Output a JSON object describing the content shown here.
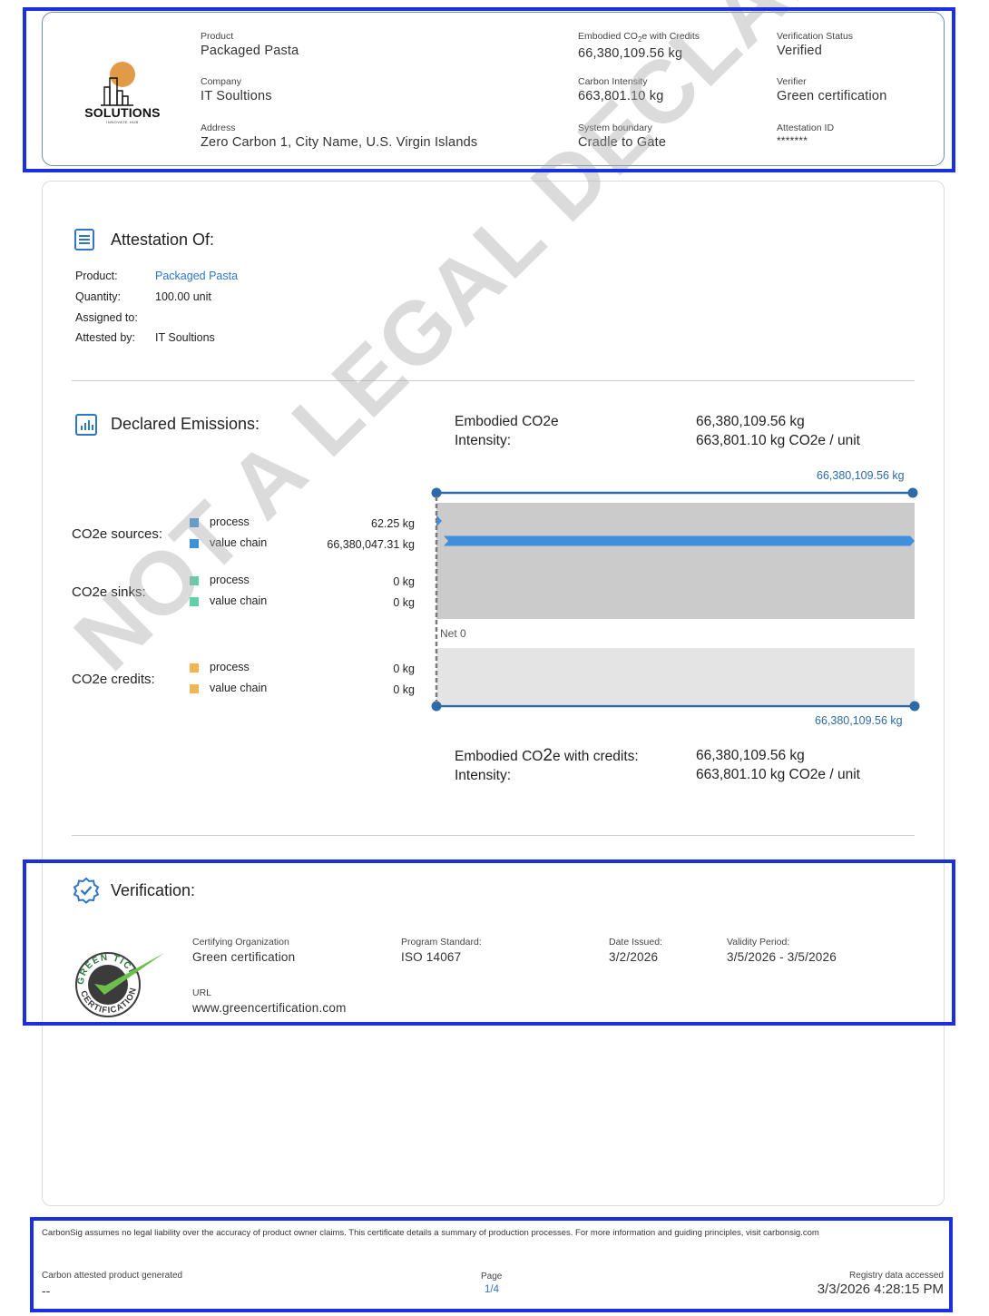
{
  "header": {
    "logo_text": "SOLUTIONS",
    "logo_subtext": "INNOVATE HUB",
    "fields": {
      "product": {
        "label": "Product",
        "value": "Packaged Pasta"
      },
      "company": {
        "label": "Company",
        "value": "IT Soultions"
      },
      "address": {
        "label": "Address",
        "value": "Zero Carbon 1, City Name, U.S. Virgin Islands"
      },
      "embodied": {
        "label_pre": "Embodied CO",
        "label_sub": "2",
        "label_post": "e with Credits",
        "value": "66,380,109.56 kg"
      },
      "intensity": {
        "label": "Carbon Intensity",
        "value": "663,801.10 kg"
      },
      "boundary": {
        "label": "System boundary",
        "value": "Cradle to Gate"
      },
      "verification_status": {
        "label": "Verification Status",
        "value": "Verified"
      },
      "verifier": {
        "label": "Verifier",
        "value": "Green certification"
      },
      "attestation_id": {
        "label": "Attestation ID",
        "value": "*******"
      }
    }
  },
  "attestation": {
    "title": "Attestation Of:",
    "rows": [
      {
        "key": "Product:",
        "value": "Packaged Pasta"
      },
      {
        "key": "Quantity:",
        "value": "100.00 unit"
      },
      {
        "key": "Assigned to:",
        "value": ""
      },
      {
        "key": "Attested by:",
        "value": "IT Soultions"
      }
    ]
  },
  "emissions": {
    "title": "Declared Emissions:",
    "embodied_label": "Embodied CO2e",
    "intensity_label": "Intensity:",
    "embodied_value": "66,380,109.56 kg",
    "intensity_value": "663,801.10 kg CO2e / unit",
    "top_total_label": "66,380,109.56 kg",
    "bottom_total_label": "66,380,109.56 kg",
    "net_label": "Net 0",
    "credits_label_pre": "Embodied CO",
    "credits_label_sub": "2",
    "credits_label_post": "e with credits:",
    "credits_intensity_label": "Intensity:",
    "credits_value": "66,380,109.56 kg",
    "credits_intensity_value": "663,801.10 kg CO2e / unit",
    "categories": [
      {
        "label": "CO2e sources:",
        "items": [
          {
            "name": "process",
            "value": "62.25 kg",
            "color": "#3f8fdd"
          },
          {
            "name": "value chain",
            "value": "66,380,047.31 kg",
            "color": "#3f8fdd"
          }
        ]
      },
      {
        "label": "CO2e sinks:",
        "items": [
          {
            "name": "process",
            "value": "0 kg",
            "color": "#5fd0a8"
          },
          {
            "name": "value chain",
            "value": "0 kg",
            "color": "#5fd0a8"
          }
        ]
      },
      {
        "label": "CO2e credits:",
        "items": [
          {
            "name": "process",
            "value": "0 kg",
            "color": "#f2b556"
          },
          {
            "name": "value chain",
            "value": "0 kg",
            "color": "#f2b556"
          }
        ]
      }
    ]
  },
  "chart_data": {
    "type": "bar",
    "orientation": "horizontal",
    "categories": [
      "sources process",
      "sources value chain"
    ],
    "values": [
      62.25,
      66380047.31
    ],
    "total": 66380109.56,
    "xlim": [
      0,
      66380109.56
    ],
    "colors": {
      "bar": "#3f8fdd",
      "axis": "#2d6aa8",
      "positive_bg": "#cbcbcb",
      "negative_bg": "#e4e4e4"
    }
  },
  "verification": {
    "title": "Verification:",
    "badge_text_top": "GREEN TICK",
    "badge_text_bottom": "CERTIFICATION",
    "fields": {
      "org": {
        "label": "Certifying Organization",
        "value": "Green certification"
      },
      "standard": {
        "label": "Program Standard:",
        "value": "ISO 14067"
      },
      "date": {
        "label": "Date Issued:",
        "value": "3/2/2026"
      },
      "validity": {
        "label": "Validity Period:",
        "value": "3/5/2026 - 3/5/2026"
      },
      "url": {
        "label": "URL",
        "value": "www.greencertification.com"
      }
    }
  },
  "watermark": "NOT A LEGAL DECLARATION",
  "footer": {
    "disclaimer": "CarbonSig assumes no legal liability over the accuracy of product owner claims. This certificate details a summary of production processes. For more information and guiding principles, visit carbonsig.com",
    "generated_label": "Carbon attested product generated",
    "generated_value": "--",
    "page_label": "Page",
    "page_value": "1/4",
    "accessed_label": "Registry data accessed",
    "accessed_value": "3/3/2026 4:28:15 PM"
  }
}
